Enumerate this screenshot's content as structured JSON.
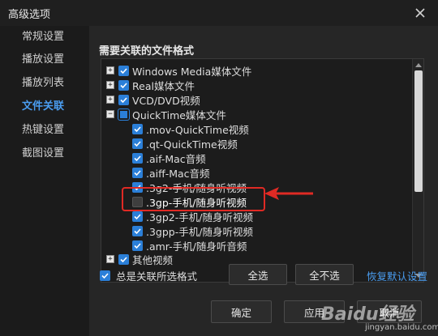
{
  "window": {
    "title": "高级选项",
    "close_icon": "close-icon"
  },
  "sidebar": {
    "items": [
      {
        "label": "常规设置",
        "active": false
      },
      {
        "label": "播放设置",
        "active": false
      },
      {
        "label": "播放列表",
        "active": false
      },
      {
        "label": "文件关联",
        "active": true
      },
      {
        "label": "热键设置",
        "active": false
      },
      {
        "label": "截图设置",
        "active": false
      }
    ]
  },
  "main": {
    "section_title": "需要关联的文件格式",
    "tree": [
      {
        "label": "Windows Media媒体文件",
        "level": 0,
        "expander": "+",
        "state": "checked"
      },
      {
        "label": "Real媒体文件",
        "level": 0,
        "expander": "+",
        "state": "checked"
      },
      {
        "label": "VCD/DVD视频",
        "level": 0,
        "expander": "+",
        "state": "checked"
      },
      {
        "label": "QuickTime媒体文件",
        "level": 0,
        "expander": "-",
        "state": "partial"
      },
      {
        "label": ".mov-QuickTime视频",
        "level": 1,
        "state": "checked"
      },
      {
        "label": ".qt-QuickTime视频",
        "level": 1,
        "state": "checked"
      },
      {
        "label": ".aif-Mac音频",
        "level": 1,
        "state": "checked"
      },
      {
        "label": ".aiff-Mac音频",
        "level": 1,
        "state": "checked"
      },
      {
        "label": ".3g2-手机/随身听视频",
        "level": 1,
        "state": "checked"
      },
      {
        "label": ".3gp-手机/随身听视频",
        "level": 1,
        "state": "unchecked"
      },
      {
        "label": ".3gp2-手机/随身听视频",
        "level": 1,
        "state": "checked"
      },
      {
        "label": ".3gpp-手机/随身听视频",
        "level": 1,
        "state": "checked"
      },
      {
        "label": ".amr-手机/随身听音频",
        "level": 1,
        "state": "checked"
      },
      {
        "label": "其他视频",
        "level": 0,
        "expander": "+",
        "state": "checked"
      }
    ],
    "always_associate_label": "总是关联所选格式",
    "always_associate_checked": true,
    "select_all": "全选",
    "select_none": "全不选",
    "restore_default": "恢复默认设置",
    "ok": "确定",
    "apply": "应用",
    "cancel": "取消"
  },
  "watermark": {
    "text": "Baidu经验",
    "sub": "jingyan.baidu.com"
  },
  "colors": {
    "accent": "#2b7fd8",
    "link": "#4a9df0",
    "highlight": "#e02a24",
    "background": "#262626"
  }
}
